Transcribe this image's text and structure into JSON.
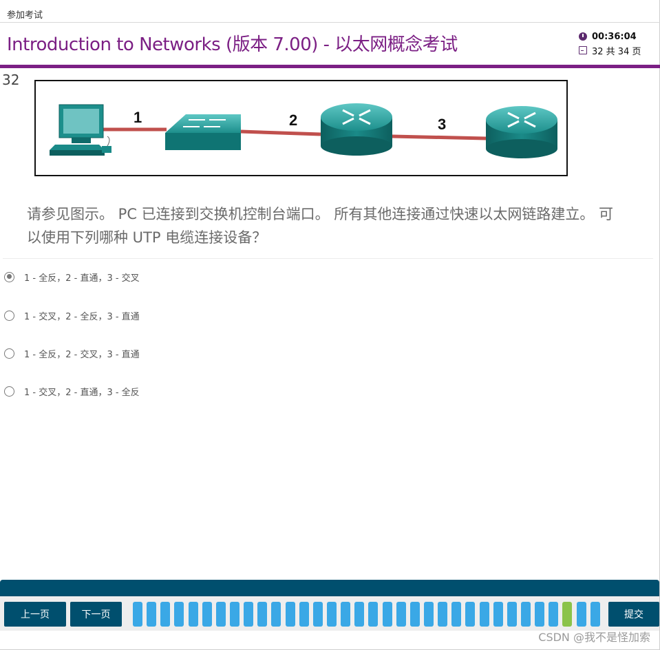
{
  "topbar": {
    "crumb": "参加考试"
  },
  "header": {
    "title": "Introduction to Networks (版本 7.00) - 以太网概念考试",
    "timer": "00:36:04",
    "page_counter": "32 共 34 页"
  },
  "question": {
    "number": "32",
    "text": "请参见图示。 PC 已连接到交换机控制台端口。 所有其他连接通过快速以太网链路建立。 可以使用下列哪种 UTP 电缆连接设备？",
    "exhibit_labels": [
      "1",
      "2",
      "3"
    ]
  },
  "options": [
    {
      "label": "1 - 全反，2 - 直通，3 - 交叉",
      "selected": true
    },
    {
      "label": "1 - 交叉，2 - 全反，3 - 直通",
      "selected": false
    },
    {
      "label": "1 - 全反，2 - 交叉，3 - 直通",
      "selected": false
    },
    {
      "label": "1 - 交叉，2 - 直通，3 - 全反",
      "selected": false
    }
  ],
  "nav": {
    "prev_label": "上一页",
    "next_label": "下一页",
    "submit_label": "提交",
    "total_pages": 34,
    "current_page": 32
  },
  "watermark": "CSDN @我不是怪加索",
  "colors": {
    "accent_purple": "#7b1f84",
    "nav_blue": "#004f6e",
    "page_dot_blue": "#3aa8e6",
    "page_dot_current": "#8bc34a",
    "cable_red": "#c0504d",
    "device_teal": "#1a8a8a"
  }
}
